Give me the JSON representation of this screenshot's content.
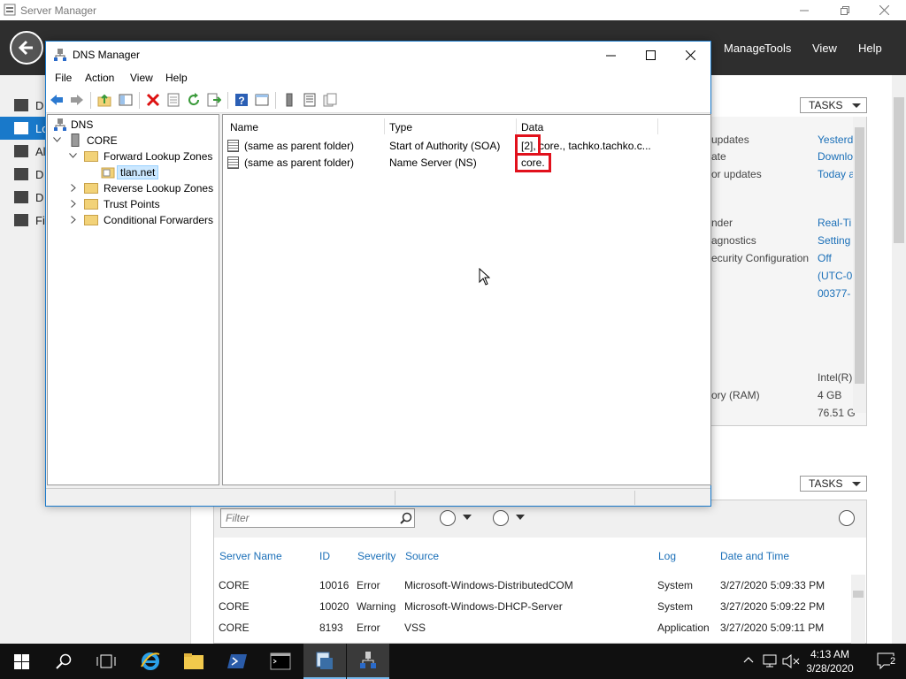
{
  "server_manager": {
    "title": "Server Manager",
    "menu": [
      "Manage",
      "Tools",
      "View",
      "Help"
    ],
    "nav_items": [
      "D",
      "Lo",
      "Al",
      "D",
      "D",
      "Fi"
    ],
    "tasks_label": "TASKS",
    "properties": [
      {
        "label": "updates",
        "value": "Yesterd"
      },
      {
        "label": "ate",
        "value": "Downlo"
      },
      {
        "label": "or updates",
        "value": "Today a"
      },
      {
        "label": "nder",
        "value": "Real-Ti"
      },
      {
        "label": "agnostics",
        "value": "Setting"
      },
      {
        "label": "ecurity Configuration",
        "value": "Off"
      },
      {
        "label": "",
        "value": "(UTC-0"
      },
      {
        "label": "",
        "value": "00377-"
      },
      {
        "label": "",
        "value": "Intel(R)"
      },
      {
        "label": "ory (RAM)",
        "value": "4 GB"
      },
      {
        "label": "",
        "value": "76.51 G"
      }
    ],
    "events": {
      "filter_placeholder": "Filter",
      "columns": [
        "Server Name",
        "ID",
        "Severity",
        "Source",
        "Log",
        "Date and Time"
      ],
      "rows": [
        {
          "server": "CORE",
          "id": "10016",
          "severity": "Error",
          "source": "Microsoft-Windows-DistributedCOM",
          "log": "System",
          "datetime": "3/27/2020 5:09:33 PM"
        },
        {
          "server": "CORE",
          "id": "10020",
          "severity": "Warning",
          "source": "Microsoft-Windows-DHCP-Server",
          "log": "System",
          "datetime": "3/27/2020 5:09:22 PM"
        },
        {
          "server": "CORE",
          "id": "8193",
          "severity": "Error",
          "source": "VSS",
          "log": "Application",
          "datetime": "3/27/2020 5:09:11 PM"
        }
      ]
    }
  },
  "dns_manager": {
    "title": "DNS Manager",
    "menu": [
      "File",
      "Action",
      "View",
      "Help"
    ],
    "tree": {
      "root": "DNS",
      "server": "CORE",
      "forward_zones": "Forward Lookup Zones",
      "zone": "tlan.net",
      "reverse_zones": "Reverse Lookup Zones",
      "trust_points": "Trust Points",
      "conditional_forwarders": "Conditional Forwarders"
    },
    "list": {
      "columns": [
        "Name",
        "Type",
        "Data"
      ],
      "rows": [
        {
          "name": "(same as parent folder)",
          "type": "Start of Authority (SOA)",
          "data_serial": "[2]",
          "data_rest": ", core., tachko.tachko.c..."
        },
        {
          "name": "(same as parent folder)",
          "type": "Name Server (NS)",
          "data_serial": "core.",
          "data_rest": ""
        }
      ]
    },
    "highlight_color": "#e1111c"
  },
  "taskbar": {
    "time": "4:13 AM",
    "date": "3/28/2020",
    "notifications": "2"
  }
}
